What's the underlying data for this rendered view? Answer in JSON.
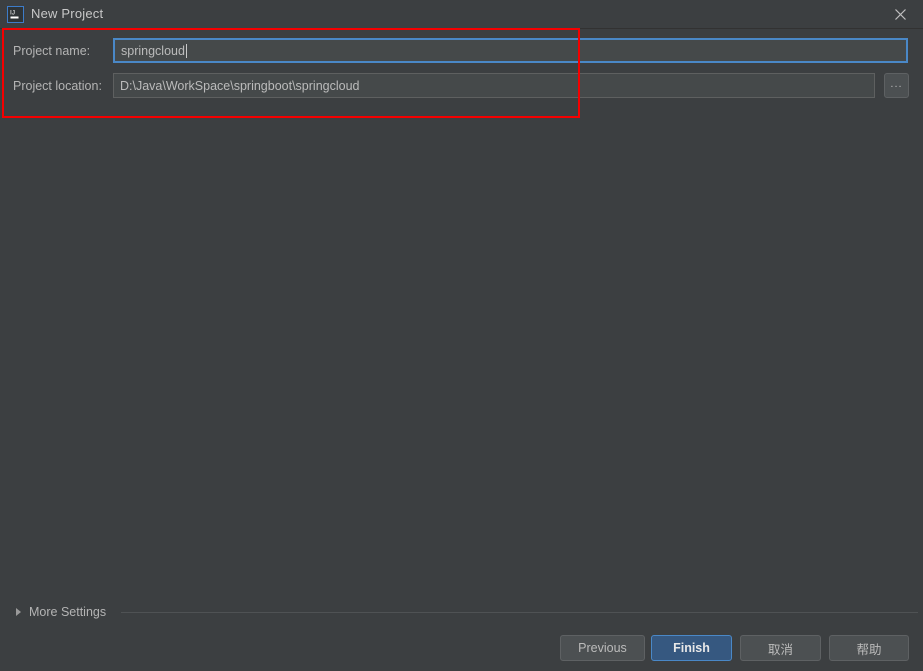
{
  "window": {
    "title": "New Project",
    "app_icon": "intellij-idea-icon",
    "close_icon": "close-icon",
    "background_color": "#3c3f41",
    "accent_color": "#4a88c7",
    "annotation_color": "#f60000"
  },
  "form": {
    "project_name": {
      "label": "Project name:",
      "value": "springcloud",
      "placeholder": ""
    },
    "project_location": {
      "label": "Project location:",
      "value": "D:\\Java\\WorkSpace\\springboot\\springcloud",
      "placeholder": "",
      "browse_label": "..."
    }
  },
  "more_settings": {
    "label": "More Settings",
    "expanded": false,
    "arrow_icon": "chevron-right-icon"
  },
  "buttons": {
    "previous": "Previous",
    "finish": "Finish",
    "cancel": "取消",
    "help": "帮助"
  }
}
